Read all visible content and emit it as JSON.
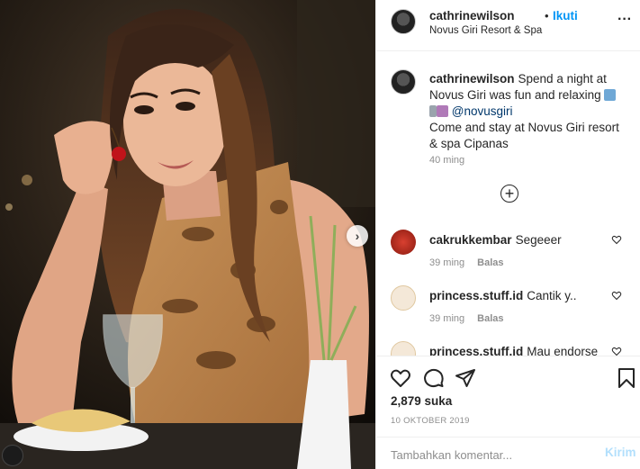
{
  "post": {
    "username": "cathrinewilson",
    "follow_separator": "•",
    "follow_label": "Ikuti",
    "location": "Novus Giri Resort & Spa",
    "more_label": "···"
  },
  "caption": {
    "username": "cathrinewilson",
    "text_before": "Spend a night at Novus Giri was fun and relaxing",
    "mention": "@novusgiri",
    "text_after": "Come and stay at Novus Giri resort & spa Cipanas",
    "time": "40 ming"
  },
  "load_more_label": "+",
  "comments": [
    {
      "username": "cakrukkembar",
      "text": "Segeeer",
      "time": "39 ming",
      "reply": "Balas",
      "avatar_color": "#c0392b"
    },
    {
      "username": "princess.stuff.id",
      "text": "Cantik y..",
      "time": "39 ming",
      "reply": "Balas",
      "avatar_color": "#e8d6b8"
    },
    {
      "username": "princess.stuff.id",
      "text": "Mau endorse",
      "time": "",
      "reply": "",
      "avatar_color": "#e8d6b8"
    }
  ],
  "actions": {
    "likes": "2,879 suka",
    "date": "10 OKTOBER 2019"
  },
  "add_comment": {
    "placeholder": "Tambahkan komentar...",
    "post_label": "Kirim"
  },
  "photo": {
    "next_arrow": "›"
  }
}
